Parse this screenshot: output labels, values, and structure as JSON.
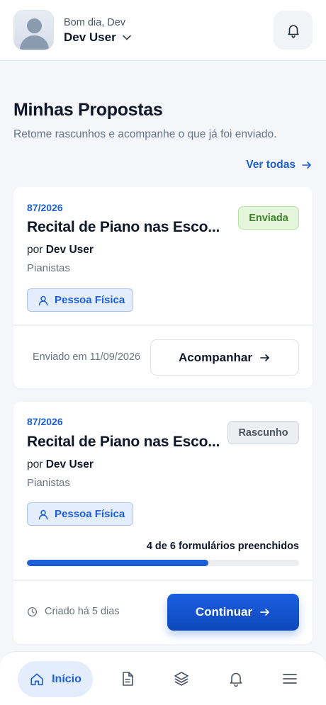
{
  "header": {
    "greeting": "Bom dia, Dev",
    "user_name": "Dev User"
  },
  "page": {
    "title": "Minhas Propostas",
    "subtitle": "Retome rascunhos e acompanhe o que já foi enviado.",
    "see_all": "Ver todas"
  },
  "proposals": [
    {
      "code": "87/2026",
      "title": "Recital de Piano nas Esco...",
      "by_prefix": "por",
      "author": "Dev User",
      "category": "Pianistas",
      "person_type": "Pessoa Física",
      "status": "Enviada",
      "sent_on": "Enviado em 11/09/2026",
      "action": "Acompanhar"
    },
    {
      "code": "87/2026",
      "title": "Recital de Piano nas Esco...",
      "by_prefix": "por",
      "author": "Dev User",
      "category": "Pianistas",
      "person_type": "Pessoa Física",
      "status": "Rascunho",
      "progress_text": "4 de 6 formulários preenchidos",
      "progress_fraction": 0.667,
      "created": "Criado há 5 dias",
      "action": "Continuar"
    }
  ],
  "nav": {
    "home_label": "Início"
  },
  "colors": {
    "accent": "#1d5fd6",
    "sent_bg": "#e3f6dc",
    "sent_text": "#3f7e2a",
    "draft_bg": "#eceef2"
  }
}
